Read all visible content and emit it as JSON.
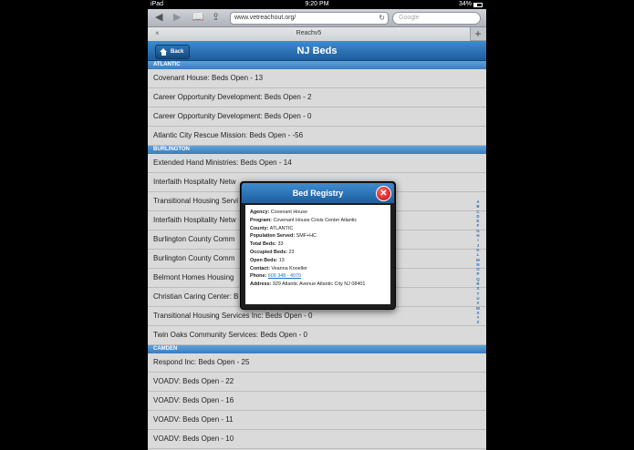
{
  "status": {
    "device": "iPad",
    "time": "9:20 PM",
    "battery": "34%"
  },
  "browser": {
    "url": "www.vetreachout.org/",
    "search_placeholder": "Google",
    "tab_title": "Reachv5"
  },
  "header": {
    "title": "NJ Beds",
    "back_label": "Back"
  },
  "sections": [
    {
      "name": "ATLANTIC",
      "items": [
        "Covenant House: Beds Open - 13",
        "Career Opportunity Development: Beds Open - 2",
        "Career Opportunity Development: Beds Open - 0",
        "Atlantic City Rescue Mission: Beds Open - -56"
      ]
    },
    {
      "name": "BURLINGTON",
      "items": [
        "Extended Hand Ministries: Beds Open - 14",
        "Interfaith Hospitality Netw",
        "Transitional Housing Servi",
        "Interfaith Hospitality Netw",
        "Burlington County Comm",
        "Burlington County Comm",
        "Belmont Homes Housing",
        "Christian Caring Center: B",
        "Transitional Housing Services Inc: Beds Open - 0",
        "Twin Oaks Community Services: Beds Open - 0"
      ]
    },
    {
      "name": "CAMDEN",
      "items": [
        "Respond Inc: Beds Open - 25",
        "VOADV: Beds Open - 22",
        "VOADV: Beds Open - 16",
        "VOADV: Beds Open - 11",
        "VOADV: Beds Open - 10"
      ]
    }
  ],
  "alpha_index": [
    "A",
    "B",
    "C",
    "D",
    "E",
    "F",
    "G",
    "H",
    "I",
    "J",
    "K",
    "L",
    "M",
    "N",
    "O",
    "P",
    "Q",
    "R",
    "S",
    "T",
    "U",
    "V",
    "W",
    "X",
    "Y",
    "Z"
  ],
  "modal": {
    "title": "Bed Registry",
    "fields": [
      {
        "label": "Agency:",
        "value": "Covenant House"
      },
      {
        "label": "Program:",
        "value": "Covenant House Crisis Center Atlantic"
      },
      {
        "label": "County:",
        "value": "ATLANTIC"
      },
      {
        "label": "Population Served:",
        "value": "SMF+HC"
      },
      {
        "label": "Total Beds:",
        "value": "33"
      },
      {
        "label": "Occupied Beds:",
        "value": "23"
      },
      {
        "label": "Open Beds:",
        "value": "13"
      },
      {
        "label": "Contact:",
        "value": "Veanna Knoeller"
      },
      {
        "label": "Phone:",
        "value": "609 348 - 4070",
        "link": true
      },
      {
        "label": "Address:",
        "value": "929 Atlantic Avenue Atlantic City NJ 08401"
      }
    ]
  }
}
